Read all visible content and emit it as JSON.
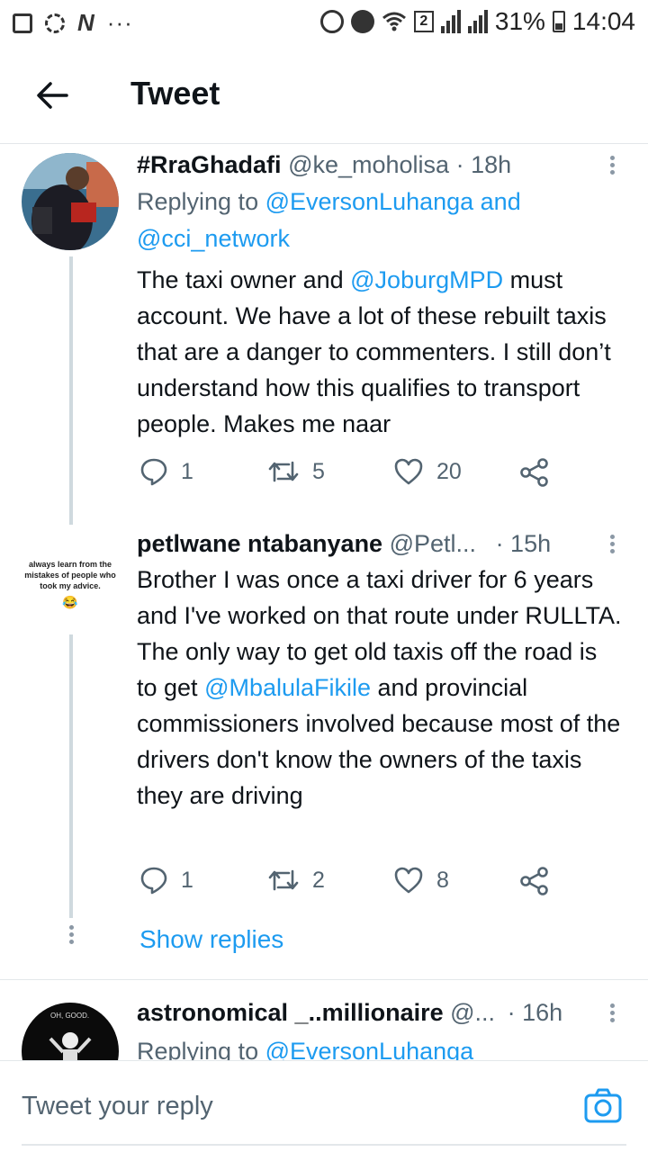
{
  "status_bar": {
    "battery": "31%",
    "time": "14:04",
    "sim": "2"
  },
  "header": {
    "title": "Tweet"
  },
  "tweets": [
    {
      "name": "#RraGhadafi",
      "handle": "@ke_moholisa",
      "time": "· 18h",
      "replying_prefix": "Replying to ",
      "replying_to": "@EversonLuhanga and",
      "replying_to2": "@cci_network",
      "text_parts": [
        "The taxi owner and ",
        "@JoburgMPD",
        " must account. We have a lot of these rebuilt taxis that are a danger to commenters. I still don’t understand how this qualifies to transport people. Makes me naar"
      ],
      "replies": "1",
      "retweets": "5",
      "likes": "20"
    },
    {
      "name": "petlwane ntabanyane",
      "handle": "@Petl...",
      "time": "· 15h",
      "avatar_text": [
        "always learn from the",
        "mistakes of people who",
        "took my advice.",
        "😂"
      ],
      "text_parts": [
        "Brother I was once a taxi driver for 6 years and I've worked on that route under RULLTA. The only way to get old taxis off the road is to get ",
        "@MbalulaFikile",
        " and provincial commissioners involved because most of the drivers  don't know the owners of the taxis they are driving"
      ],
      "replies": "1",
      "retweets": "2",
      "likes": "8",
      "show_replies": "Show replies"
    },
    {
      "name": "astronomical _..millionaire",
      "handle": "@...",
      "time": "· 16h",
      "avatar_text": "OH, GOOD.",
      "replying_prefix": "Replying to ",
      "replying_to": "@EversonLuhanga"
    }
  ],
  "reply_bar": {
    "placeholder": "Tweet your reply"
  },
  "colors": {
    "link": "#1d9bf0",
    "muted": "#536471",
    "divider": "#e3e7ea"
  }
}
